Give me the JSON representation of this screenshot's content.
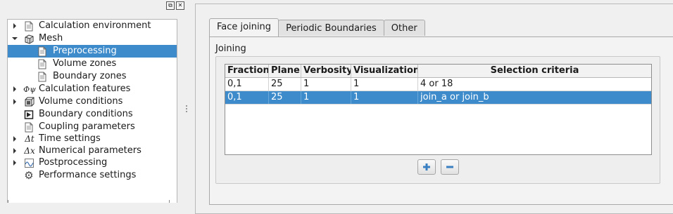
{
  "tree": {
    "items": [
      {
        "label": "Calculation environment",
        "icon": "document-icon",
        "expander": "right",
        "selected": false
      },
      {
        "label": "Mesh",
        "icon": "mesh-cube-icon",
        "expander": "down",
        "selected": false
      },
      {
        "label": "Preprocessing",
        "icon": "document-icon",
        "expander": "none",
        "selected": true
      },
      {
        "label": "Volume zones",
        "icon": "document-icon",
        "expander": "none",
        "selected": false
      },
      {
        "label": "Boundary zones",
        "icon": "document-icon",
        "expander": "none",
        "selected": false
      },
      {
        "label": "Calculation features",
        "icon": "phi-psi-icon",
        "expander": "right",
        "selected": false
      },
      {
        "label": "Volume conditions",
        "icon": "volume-cube-icon",
        "expander": "right",
        "selected": false
      },
      {
        "label": "Boundary conditions",
        "icon": "boundary-icon",
        "expander": "none",
        "selected": false
      },
      {
        "label": "Coupling parameters",
        "icon": "document-icon",
        "expander": "none",
        "selected": false
      },
      {
        "label": "Time settings",
        "icon": "delta-t-icon",
        "expander": "right",
        "selected": false
      },
      {
        "label": "Numerical parameters",
        "icon": "delta-x-icon",
        "expander": "right",
        "selected": false
      },
      {
        "label": "Postprocessing",
        "icon": "wave-icon",
        "expander": "right",
        "selected": false
      },
      {
        "label": "Performance settings",
        "icon": "gear-icon",
        "expander": "none",
        "selected": false
      }
    ]
  },
  "tabs": [
    {
      "label": "Face joining",
      "active": true
    },
    {
      "label": "Periodic Boundaries",
      "active": false
    },
    {
      "label": "Other",
      "active": false
    }
  ],
  "group": {
    "title": "Joining"
  },
  "table": {
    "headers": [
      "Fraction",
      "Plane",
      "Verbosity",
      "Visualization",
      "Selection criteria"
    ],
    "rows": [
      {
        "cells": [
          "0,1",
          "25",
          "1",
          "1",
          "4 or 18"
        ],
        "selected": false
      },
      {
        "cells": [
          "0,1",
          "25",
          "1",
          "1",
          "join_a or join_b"
        ],
        "selected": true
      }
    ]
  },
  "buttons": {
    "add_icon": "plus-icon",
    "remove_icon": "minus-icon"
  },
  "colors": {
    "selection": "#3d8bcb",
    "button_icon": "#3a7fc1"
  }
}
